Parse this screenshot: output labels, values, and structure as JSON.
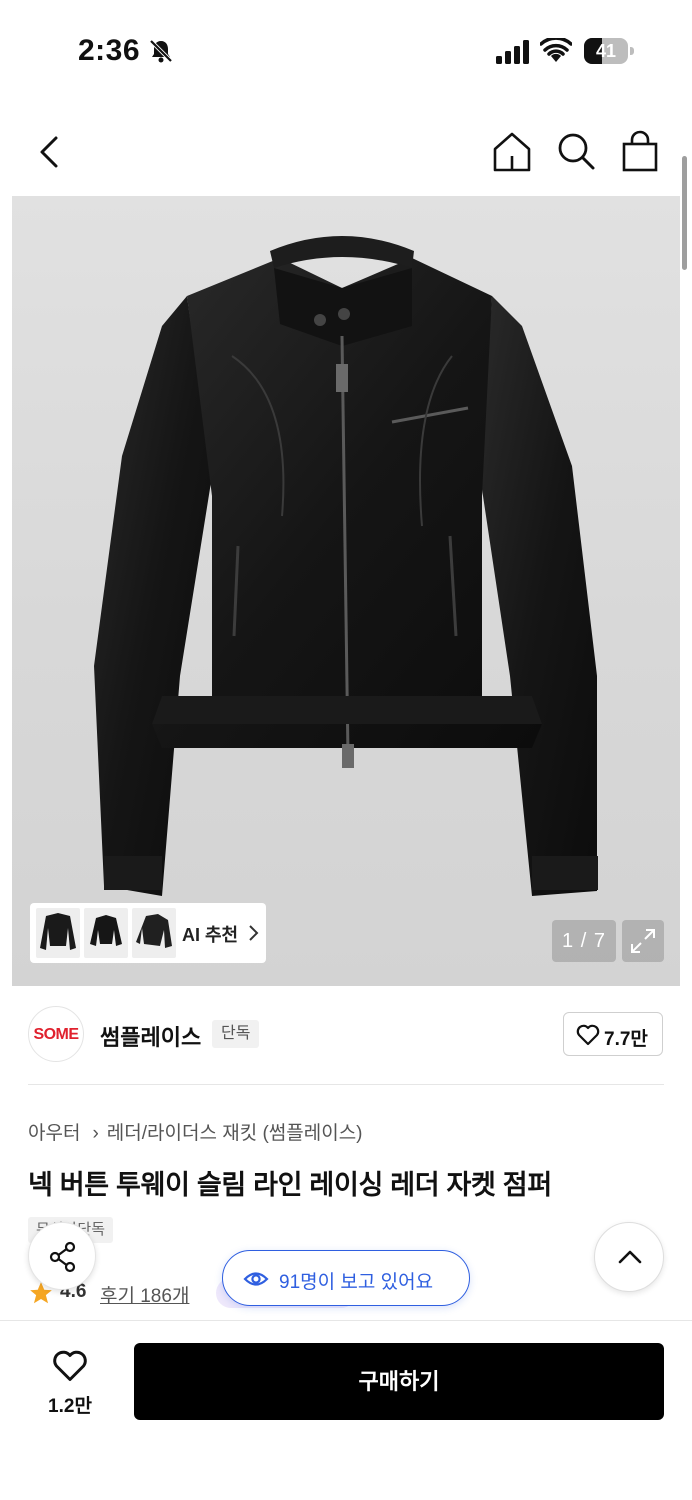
{
  "status_bar": {
    "time": "2:36",
    "battery": "41",
    "battery_level": 0.41
  },
  "nav": {
    "back_icon": "chevron-left-icon",
    "home_icon": "home-icon",
    "search_icon": "search-icon",
    "cart_icon": "shopping-bag-icon"
  },
  "gallery": {
    "ai_label": "AI 추천",
    "counter": "1 / 7",
    "thumbnails": [
      "jacket-front",
      "jacket-back",
      "jacket-side"
    ]
  },
  "brand": {
    "name": "썸플레이스",
    "tag": "단독",
    "likes": "7.7만",
    "logo_text": "SOME"
  },
  "product": {
    "breadcrumb": [
      "아우터",
      "레더/라이더스 재킷 (썸플레이스)"
    ],
    "title": "넥 버튼 투웨이 슬림 라인 레이싱 레더 자켓 점퍼",
    "badge": "무신사단독",
    "rating": "4.6",
    "reviews": "후기 186개",
    "viewers": "91명이 보고 있어요"
  },
  "bottom": {
    "wish_count": "1.2만",
    "buy_label": "구매하기"
  },
  "colors": {
    "accent_blue": "#2f5fe0",
    "brand_red": "#e0212e",
    "star": "#f5a623",
    "buy_bg": "#000000"
  }
}
